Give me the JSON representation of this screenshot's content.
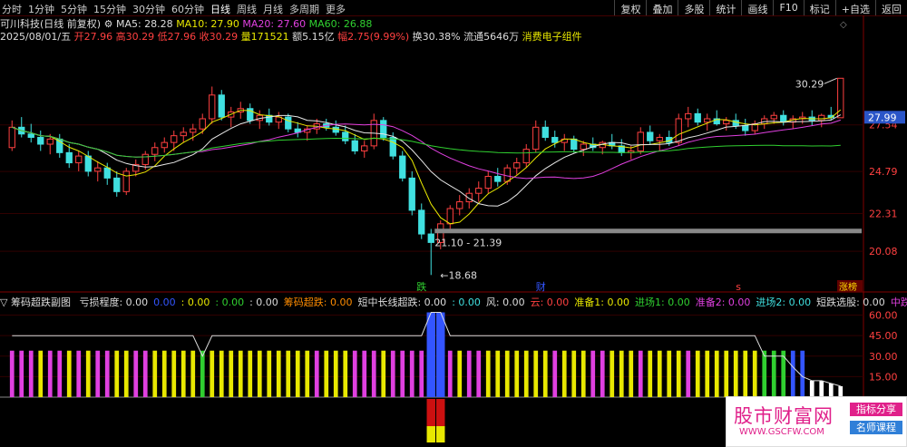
{
  "toolbar": {
    "periods": [
      "分时",
      "1分钟",
      "5分钟",
      "15分钟",
      "30分钟",
      "60分钟",
      "日线",
      "周线",
      "月线",
      "多周期",
      "更多"
    ],
    "active_period": "日线",
    "right_buttons": [
      "复权",
      "叠加",
      "多股",
      "统计",
      "画线",
      "F10",
      "标记",
      "+自选",
      "返回"
    ]
  },
  "title": {
    "name": "可川科技(日线 前复权)",
    "ma5": "MA5: 28.28",
    "ma10": "MA10: 27.90",
    "ma20": "MA20: 27.60",
    "ma60": "MA60: 26.88"
  },
  "quote": {
    "date": "2025/08/01/五",
    "open": "开27.96",
    "high": "高30.29",
    "low": "低27.96",
    "close": "收30.29",
    "volume": "量171521",
    "amount": "额5.15亿",
    "change": "幅2.75(9.99%)",
    "turnover": "换30.38%",
    "float": "流通5646万",
    "sector": "消费电子组件"
  },
  "price_axis": {
    "ticks": [
      "27.54",
      "24.79",
      "22.31",
      "20.08"
    ],
    "current": "27.99"
  },
  "annotations": {
    "high_label": "30.29",
    "low_label": "18.68",
    "range_label": "21.10 - 21.39",
    "marker_die": "跌",
    "marker_cai": "财",
    "marker_s": "s",
    "marker_zhangting": "涨榜"
  },
  "indicator": {
    "name": "筹码超跌副图",
    "items": [
      {
        "label": "亏损程度: 0.00",
        "color": "#dddddd"
      },
      {
        "label": "0.00",
        "color": "#3355ff"
      },
      {
        "label": ": 0.00",
        "color": "#e8e800"
      },
      {
        "label": ": 0.00",
        "color": "#30d030"
      },
      {
        "label": ": 0.00",
        "color": "#dddddd"
      },
      {
        "label": "筹码超跌: 0.00",
        "color": "#ff8c00"
      },
      {
        "label": "短中长线超跌: 0.00",
        "color": "#dddddd"
      },
      {
        "label": ": 0.00",
        "color": "#40e0e0"
      },
      {
        "label": "风: 0.00",
        "color": "#dddddd"
      },
      {
        "label": "云: 0.00",
        "color": "#ff4040"
      },
      {
        "label": "准备1: 0.00",
        "color": "#e8e800"
      },
      {
        "label": "进场1: 0.00",
        "color": "#30d030"
      },
      {
        "label": "准备2: 0.00",
        "color": "#e040e0"
      },
      {
        "label": "进场2: 0.00",
        "color": "#40e0e0"
      },
      {
        "label": "短跌选股: 0.00",
        "color": "#dddddd"
      },
      {
        "label": "中跌选股",
        "color": "#e040e0"
      }
    ],
    "axis_ticks": [
      "60.00",
      "45.00",
      "30.00",
      "15.00"
    ]
  },
  "ad": {
    "title": "股市财富网",
    "url": "WWW.GSCFW.COM",
    "btn1": "指标分享",
    "btn2": "名师课程"
  },
  "chart_data": {
    "type": "candlestick",
    "ylim": [
      18.0,
      32.5
    ],
    "candles": [
      [
        26.2,
        27.8,
        26.0,
        27.4
      ],
      [
        27.4,
        28.0,
        26.8,
        27.0
      ],
      [
        27.0,
        27.6,
        26.5,
        26.8
      ],
      [
        26.8,
        27.2,
        26.0,
        26.4
      ],
      [
        26.4,
        27.0,
        25.8,
        26.7
      ],
      [
        26.7,
        27.0,
        25.6,
        25.9
      ],
      [
        25.9,
        26.4,
        25.0,
        25.3
      ],
      [
        25.3,
        26.0,
        24.8,
        25.7
      ],
      [
        25.7,
        26.0,
        24.5,
        24.8
      ],
      [
        24.8,
        25.4,
        24.2,
        25.0
      ],
      [
        25.0,
        25.3,
        24.0,
        24.4
      ],
      [
        24.4,
        24.8,
        23.3,
        23.6
      ],
      [
        23.6,
        25.0,
        23.4,
        24.8
      ],
      [
        24.8,
        25.5,
        24.5,
        25.2
      ],
      [
        25.2,
        26.0,
        24.9,
        25.8
      ],
      [
        25.8,
        26.5,
        25.4,
        26.2
      ],
      [
        26.2,
        26.8,
        25.9,
        26.5
      ],
      [
        26.5,
        27.2,
        26.0,
        26.9
      ],
      [
        26.9,
        27.4,
        26.5,
        27.1
      ],
      [
        27.1,
        27.6,
        26.6,
        27.3
      ],
      [
        27.3,
        28.2,
        27.0,
        27.9
      ],
      [
        27.9,
        29.8,
        27.6,
        29.3
      ],
      [
        29.3,
        29.6,
        27.8,
        28.0
      ],
      [
        28.0,
        28.6,
        27.4,
        28.3
      ],
      [
        28.3,
        28.9,
        27.9,
        28.5
      ],
      [
        28.5,
        28.8,
        27.6,
        27.8
      ],
      [
        27.8,
        28.4,
        27.3,
        28.1
      ],
      [
        28.1,
        28.5,
        27.5,
        27.7
      ],
      [
        27.7,
        28.3,
        27.3,
        28.0
      ],
      [
        28.0,
        28.2,
        27.1,
        27.3
      ],
      [
        27.3,
        27.7,
        26.8,
        27.1
      ],
      [
        27.1,
        27.5,
        26.6,
        27.3
      ],
      [
        27.3,
        27.9,
        27.0,
        27.6
      ],
      [
        27.6,
        27.9,
        27.2,
        27.4
      ],
      [
        27.4,
        27.8,
        26.9,
        27.1
      ],
      [
        27.1,
        27.5,
        26.4,
        26.6
      ],
      [
        26.6,
        27.0,
        25.8,
        26.0
      ],
      [
        26.0,
        26.6,
        25.6,
        26.3
      ],
      [
        26.3,
        28.2,
        26.1,
        27.8
      ],
      [
        27.8,
        28.0,
        26.6,
        26.8
      ],
      [
        26.8,
        27.1,
        25.5,
        25.7
      ],
      [
        25.7,
        26.0,
        24.2,
        24.4
      ],
      [
        24.4,
        24.8,
        22.2,
        22.5
      ],
      [
        22.5,
        22.9,
        20.8,
        21.1
      ],
      [
        21.1,
        21.4,
        18.68,
        20.6
      ],
      [
        20.6,
        21.9,
        20.2,
        21.7
      ],
      [
        21.7,
        22.8,
        21.4,
        22.6
      ],
      [
        22.6,
        23.4,
        22.2,
        23.0
      ],
      [
        23.0,
        23.8,
        22.6,
        23.5
      ],
      [
        23.5,
        24.2,
        23.0,
        23.8
      ],
      [
        23.8,
        24.8,
        23.5,
        24.5
      ],
      [
        24.5,
        25.0,
        23.9,
        24.2
      ],
      [
        24.2,
        25.2,
        24.0,
        25.0
      ],
      [
        25.0,
        25.6,
        24.6,
        25.3
      ],
      [
        25.3,
        26.4,
        25.0,
        26.1
      ],
      [
        26.1,
        27.8,
        25.9,
        27.4
      ],
      [
        27.4,
        27.8,
        26.6,
        26.8
      ],
      [
        26.8,
        27.2,
        26.2,
        26.5
      ],
      [
        26.5,
        27.0,
        26.0,
        26.7
      ],
      [
        26.7,
        26.9,
        25.9,
        26.1
      ],
      [
        26.1,
        26.6,
        25.7,
        26.4
      ],
      [
        26.4,
        26.8,
        26.0,
        26.2
      ],
      [
        26.2,
        26.6,
        25.8,
        26.5
      ],
      [
        26.5,
        27.0,
        26.1,
        26.3
      ],
      [
        26.3,
        26.7,
        25.7,
        25.9
      ],
      [
        25.9,
        26.3,
        25.5,
        26.0
      ],
      [
        26.0,
        27.4,
        25.8,
        27.1
      ],
      [
        27.1,
        27.5,
        26.4,
        26.6
      ],
      [
        26.6,
        27.0,
        26.0,
        26.8
      ],
      [
        26.8,
        27.2,
        26.3,
        26.5
      ],
      [
        26.5,
        28.2,
        26.3,
        27.9
      ],
      [
        27.9,
        28.6,
        27.4,
        28.2
      ],
      [
        28.2,
        28.5,
        27.5,
        27.7
      ],
      [
        27.7,
        28.2,
        27.2,
        27.9
      ],
      [
        27.9,
        28.4,
        27.5,
        27.6
      ],
      [
        27.6,
        28.0,
        27.2,
        27.8
      ],
      [
        27.8,
        28.2,
        27.3,
        27.5
      ],
      [
        27.5,
        27.9,
        26.9,
        27.2
      ],
      [
        27.2,
        27.8,
        27.0,
        27.6
      ],
      [
        27.6,
        28.1,
        27.3,
        27.9
      ],
      [
        27.9,
        28.3,
        27.6,
        28.1
      ],
      [
        28.1,
        28.4,
        27.5,
        27.7
      ],
      [
        27.7,
        28.1,
        27.3,
        27.9
      ],
      [
        27.9,
        28.3,
        27.6,
        28.0
      ],
      [
        28.0,
        28.4,
        27.5,
        27.8
      ],
      [
        27.8,
        28.2,
        27.4,
        28.1
      ],
      [
        28.1,
        28.6,
        27.8,
        27.96
      ],
      [
        27.96,
        30.29,
        27.96,
        30.29
      ]
    ],
    "ma_series": [
      {
        "name": "MA5",
        "color": "#e8e800"
      },
      {
        "name": "MA10",
        "color": "#e8e8e8"
      },
      {
        "name": "MA20",
        "color": "#e040e0"
      },
      {
        "name": "MA60",
        "color": "#30d030"
      }
    ],
    "indicator_bars": {
      "ylim": [
        0,
        65
      ],
      "baseline": 3,
      "values": [
        [
          1,
          45
        ],
        [
          1,
          45
        ],
        [
          1,
          45
        ],
        [
          2,
          45
        ],
        [
          1,
          45
        ],
        [
          1,
          45
        ],
        [
          2,
          45
        ],
        [
          1,
          45
        ],
        [
          2,
          45
        ],
        [
          1,
          45
        ],
        [
          1,
          45
        ],
        [
          2,
          45
        ],
        [
          2,
          45
        ],
        [
          1,
          45
        ],
        [
          1,
          45
        ],
        [
          2,
          45
        ],
        [
          2,
          45
        ],
        [
          2,
          45
        ],
        [
          2,
          45
        ],
        [
          2,
          45
        ],
        [
          3,
          30
        ],
        [
          2,
          45
        ],
        [
          2,
          45
        ],
        [
          2,
          45
        ],
        [
          2,
          45
        ],
        [
          2,
          45
        ],
        [
          2,
          45
        ],
        [
          2,
          45
        ],
        [
          2,
          45
        ],
        [
          2,
          45
        ],
        [
          2,
          45
        ],
        [
          2,
          45
        ],
        [
          1,
          45
        ],
        [
          2,
          45
        ],
        [
          2,
          45
        ],
        [
          2,
          45
        ],
        [
          1,
          45
        ],
        [
          1,
          45
        ],
        [
          1,
          45
        ],
        [
          2,
          45
        ],
        [
          1,
          45
        ],
        [
          1,
          45
        ],
        [
          1,
          45
        ],
        [
          1,
          45
        ],
        [
          4,
          62
        ],
        [
          4,
          62
        ],
        [
          1,
          45
        ],
        [
          2,
          45
        ],
        [
          1,
          45
        ],
        [
          1,
          45
        ],
        [
          2,
          45
        ],
        [
          2,
          45
        ],
        [
          2,
          45
        ],
        [
          2,
          45
        ],
        [
          2,
          45
        ],
        [
          2,
          45
        ],
        [
          2,
          45
        ],
        [
          1,
          45
        ],
        [
          2,
          45
        ],
        [
          2,
          45
        ],
        [
          2,
          45
        ],
        [
          1,
          45
        ],
        [
          1,
          45
        ],
        [
          2,
          45
        ],
        [
          2,
          45
        ],
        [
          2,
          45
        ],
        [
          1,
          45
        ],
        [
          2,
          45
        ],
        [
          2,
          45
        ],
        [
          2,
          45
        ],
        [
          2,
          45
        ],
        [
          1,
          45
        ],
        [
          2,
          45
        ],
        [
          2,
          45
        ],
        [
          2,
          45
        ],
        [
          2,
          45
        ],
        [
          2,
          45
        ],
        [
          2,
          45
        ],
        [
          2,
          45
        ],
        [
          3,
          30
        ],
        [
          3,
          30
        ],
        [
          3,
          30
        ],
        [
          4,
          22
        ],
        [
          4,
          15
        ],
        [
          5,
          12
        ],
        [
          5,
          12
        ],
        [
          5,
          10
        ],
        [
          5,
          8
        ]
      ]
    }
  }
}
